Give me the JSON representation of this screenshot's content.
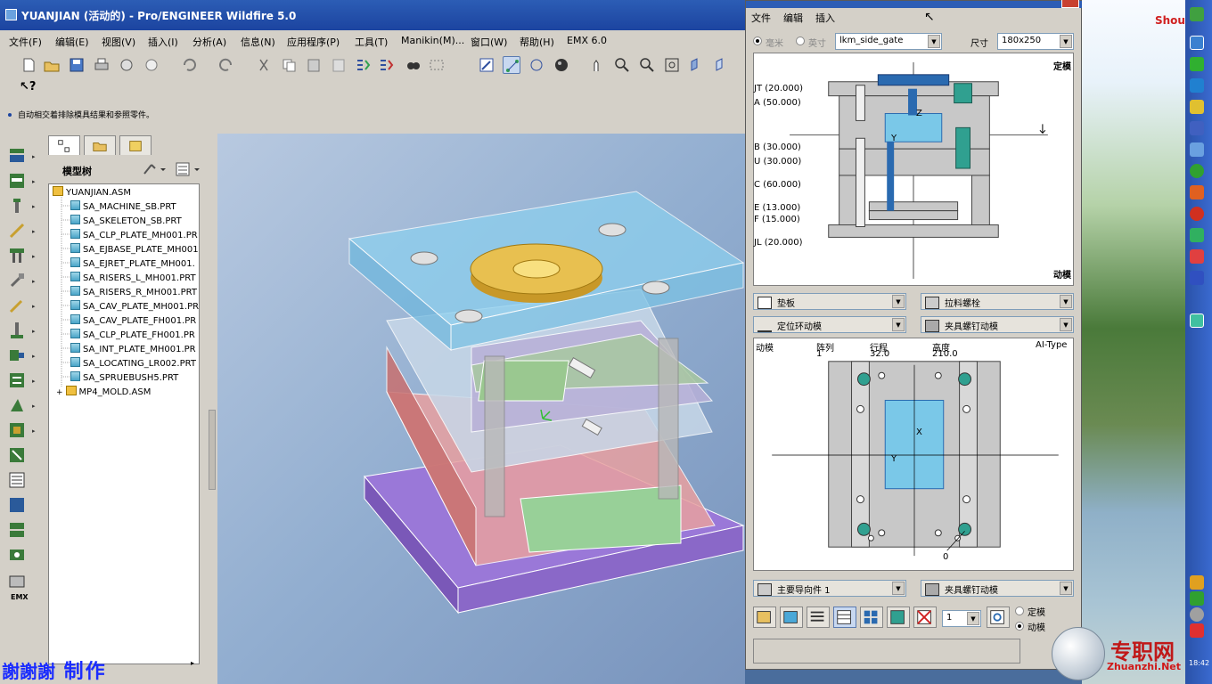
{
  "window": {
    "title": "YUANJIAN (活动的) - Pro/ENGINEER Wildfire 5.0",
    "menu": [
      "文件(F)",
      "编辑(E)",
      "视图(V)",
      "插入(I)",
      "分析(A)",
      "信息(N)",
      "应用程序(P)",
      "工具(T)",
      "Manikin(M)...",
      "窗口(W)",
      "帮助(H)",
      "EMX 6.0"
    ],
    "message": "自动相交着排除模具结果和参照零件。",
    "help_glyph": "?"
  },
  "model_tree": {
    "header": "模型树",
    "items": [
      {
        "label": "YUANJIAN.ASM",
        "type": "asm"
      },
      {
        "label": "SA_MACHINE_SB.PRT",
        "type": "prt"
      },
      {
        "label": "SA_SKELETON_SB.PRT",
        "type": "prt"
      },
      {
        "label": "SA_CLP_PLATE_MH001.PR",
        "type": "prt"
      },
      {
        "label": "SA_EJBASE_PLATE_MH001",
        "type": "prt"
      },
      {
        "label": "SA_EJRET_PLATE_MH001.",
        "type": "prt"
      },
      {
        "label": "SA_RISERS_L_MH001.PRT",
        "type": "prt"
      },
      {
        "label": "SA_RISERS_R_MH001.PRT",
        "type": "prt"
      },
      {
        "label": "SA_CAV_PLATE_MH001.PR",
        "type": "prt"
      },
      {
        "label": "SA_CAV_PLATE_FH001.PR",
        "type": "prt"
      },
      {
        "label": "SA_CLP_PLATE_FH001.PR",
        "type": "prt"
      },
      {
        "label": "SA_INT_PLATE_MH001.PR",
        "type": "prt"
      },
      {
        "label": "SA_LOCATING_LR002.PRT",
        "type": "prt"
      },
      {
        "label": "SA_SPRUEBUSH5.PRT",
        "type": "prt"
      },
      {
        "label": "MP4_MOLD.ASM",
        "type": "asm"
      }
    ]
  },
  "watermark_left": "制作",
  "watermark_left_prefix": "謝謝謝",
  "emx_label": "EMX",
  "dialog": {
    "menu": [
      "文件",
      "编辑",
      "插入"
    ],
    "unit_mm": "毫米",
    "unit_inch": "英寸",
    "template_value": "lkm_side_gate",
    "size_label": "尺寸",
    "size_value": "180x250",
    "top_labels": {
      "fixed": "定模",
      "moving": "动模"
    },
    "plates": [
      "JT (20.000)",
      "A (50.000)",
      "B (30.000)",
      "U (30.000)",
      "C (60.000)",
      "E (13.000)",
      "F (15.000)",
      "JL (20.000)"
    ],
    "axis_z": "Z",
    "axis_y": "Y",
    "axis_x": "X",
    "combos": [
      "垫板",
      "拉料螺栓",
      "定位环动模",
      "夹具螺钉动模"
    ],
    "grid_headers": {
      "side": "动模",
      "array": "阵列",
      "stroke": "行程",
      "height": "高度",
      "type": "AI-Type"
    },
    "grid_values": {
      "array": "1",
      "stroke": "32.0",
      "height": "210.0"
    },
    "zero_label": "0",
    "bottom_combos": [
      "主要导向件 1",
      "夹具螺钉动模"
    ],
    "count_value": "1",
    "radio_fixed": "定模",
    "radio_moving": "动模"
  },
  "desktop": {
    "corner_text": "Shou",
    "watermark": "专职网",
    "watermark_url": "Zhuanzhi.Net",
    "clock": "18:42"
  },
  "colors": {
    "title_blue": "#2c5db5",
    "plate_blue": "#3aa8d8",
    "mold_top": "#7fc6e8",
    "mold_purple": "#8f6ad0",
    "mold_green": "#98c898",
    "mold_red": "#d88a8a",
    "ring_gold": "#e0b040"
  }
}
